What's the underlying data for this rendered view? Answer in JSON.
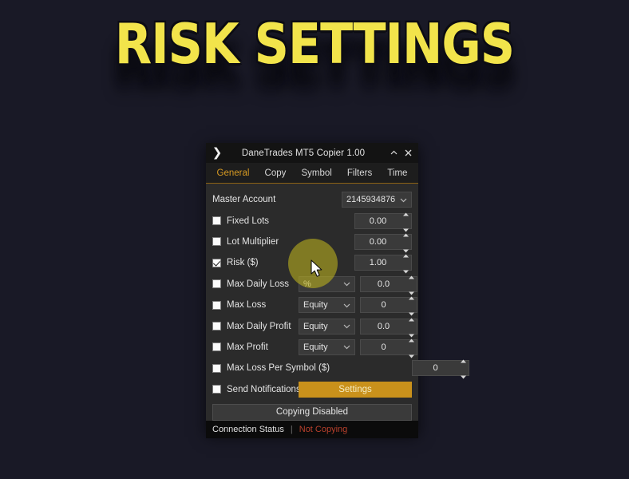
{
  "banner": {
    "title": "RISK SETTINGS",
    "color": "#f2e44b",
    "shadow_color": "#0d0d14"
  },
  "window": {
    "icon": "chevron-right-icon",
    "title": "DaneTrades MT5 Copier 1.00",
    "minimize_glyph": "chevron-up-icon",
    "close_glyph": "close-icon"
  },
  "tabs": [
    {
      "label": "General",
      "active": true
    },
    {
      "label": "Copy",
      "active": false
    },
    {
      "label": "Symbol",
      "active": false
    },
    {
      "label": "Filters",
      "active": false
    },
    {
      "label": "Time",
      "active": false
    }
  ],
  "accent_color": "#d79a22",
  "form": {
    "master_account": {
      "label": "Master Account",
      "value": "2145934876"
    },
    "rows": [
      {
        "label": "Fixed Lots",
        "checked": false,
        "unit": null,
        "value": "0.00"
      },
      {
        "label": "Lot Multiplier",
        "checked": false,
        "unit": null,
        "value": "0.00"
      },
      {
        "label": "Risk ($)",
        "checked": true,
        "unit": null,
        "value": "1.00"
      },
      {
        "label": "Max Daily Loss",
        "checked": false,
        "unit": "%",
        "value": "0.0"
      },
      {
        "label": "Max Loss",
        "checked": false,
        "unit": "Equity",
        "value": "0"
      },
      {
        "label": "Max Daily Profit",
        "checked": false,
        "unit": "Equity",
        "value": "0.0"
      },
      {
        "label": "Max Profit",
        "checked": false,
        "unit": "Equity",
        "value": "0"
      },
      {
        "label": "Max Loss Per Symbol ($)",
        "checked": false,
        "unit": null,
        "value": "0"
      }
    ],
    "notifications": {
      "label": "Send Notifications",
      "checked": false,
      "button_label": "Settings",
      "button_color": "#c9911b"
    },
    "copying_button": {
      "label": "Copying Disabled"
    }
  },
  "statusbar": {
    "label": "Connection Status",
    "separator": "|",
    "value": "Not Copying",
    "value_color": "#b9402c"
  }
}
